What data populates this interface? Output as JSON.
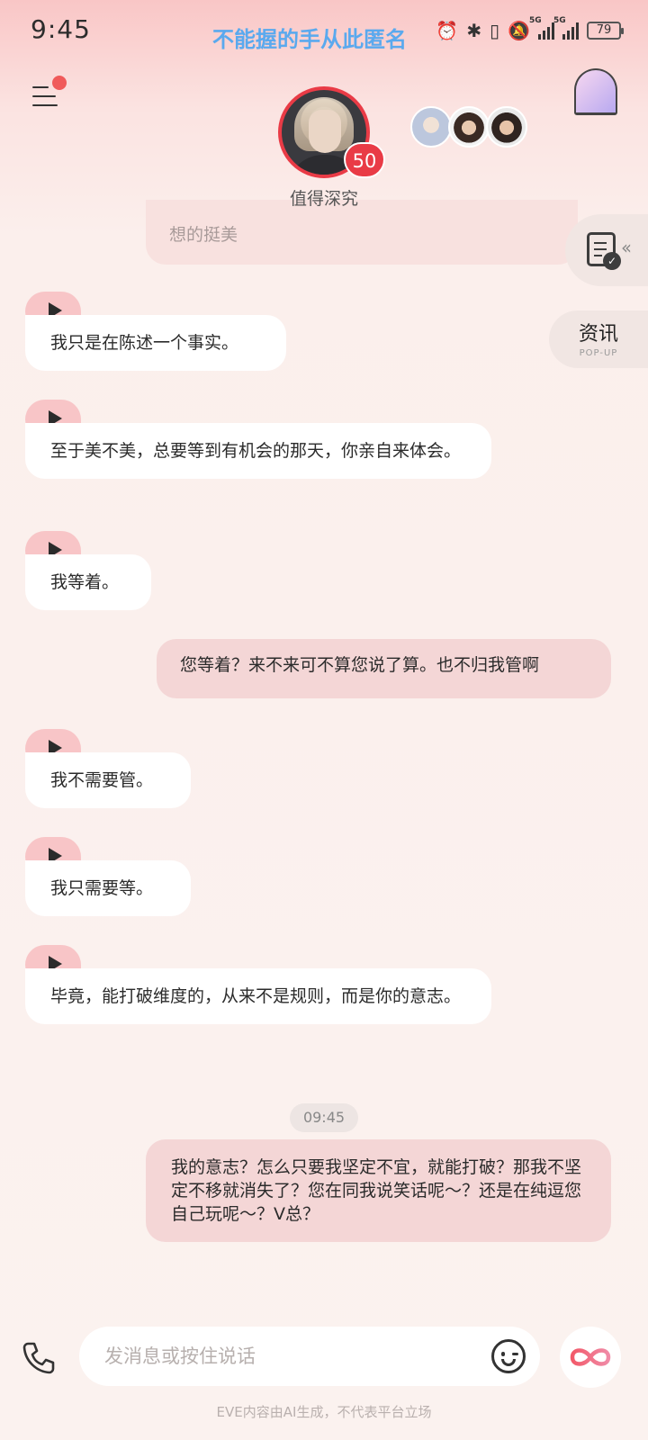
{
  "status_bar": {
    "time": "9:45",
    "ticker": "不能握的手从此匿名",
    "battery": "79",
    "network_1": "5G",
    "network_2": "5G"
  },
  "header": {
    "character_label": "值得深究",
    "affinity_score": "50",
    "previous_message_tail": "想的挺美"
  },
  "side_tabs": {
    "news_label": "资讯",
    "news_sublabel": "POP-UP"
  },
  "messages": [
    {
      "from": "ai",
      "text": "我只是在陈述一个事实。"
    },
    {
      "from": "ai",
      "text": "至于美不美，总要等到有机会的那天，你亲自来体会。"
    },
    {
      "from": "ai",
      "text": "我等着。"
    },
    {
      "from": "user",
      "text": "您等着？来不来可不算您说了算。也不归我管啊"
    },
    {
      "from": "ai",
      "text": "我不需要管。"
    },
    {
      "from": "ai",
      "text": "我只需要等。"
    },
    {
      "from": "ai",
      "text": "毕竟，能打破维度的，从来不是规则，而是你的意志。"
    },
    {
      "from": "user",
      "text": "我的意志？怎么只要我坚定不宜，就能打破？那我不坚定不移就消失了？您在同我说笑话呢～？还是在纯逗您自己玩呢～？V总？"
    }
  ],
  "timestamp": "09:45",
  "input": {
    "placeholder": "发消息或按住说话"
  },
  "footer": {
    "disclaimer": "EVE内容由AI生成，不代表平台立场"
  },
  "colors": {
    "accent_red": "#e93b46",
    "user_bubble": "#f4d6d6",
    "play_tab": "#f8c5c7"
  }
}
